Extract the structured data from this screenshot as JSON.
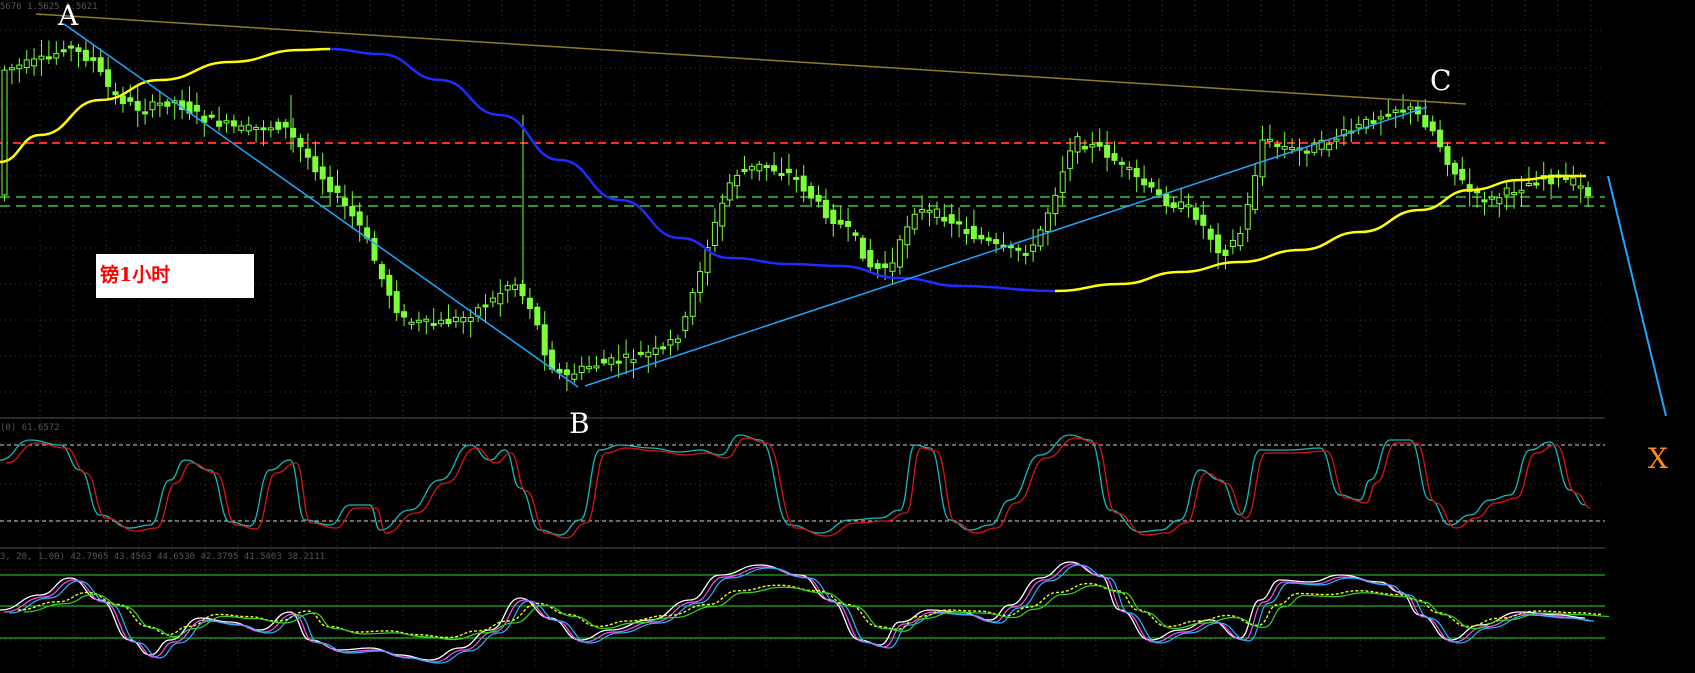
{
  "chart": {
    "symbol_caption": "镑1小时",
    "top_readout": "5676 1.5625 1.5621",
    "stoch_readout": "(0) 61.6572",
    "kdj_readout": "3, 20, 1.00) 42.7965 43.4563 44.6530 42.3795 41.5403 38.2111"
  },
  "wave_labels": {
    "a": "A",
    "b": "B",
    "c": "C",
    "x": "X"
  },
  "colors": {
    "background": "#000000",
    "grid": "#3a3a3a",
    "candle": "#7cff3a",
    "ma_yellow": "#ffff00",
    "ma_blue": "#1f2bff",
    "trendline": "#1ea6ff",
    "top_line": "#8b7d2a",
    "red_level": "#ff2a2a",
    "green_level": "#3fbf3f",
    "stoch_main": "#18b8b8",
    "stoch_signal": "#d81414",
    "kdj_white": "#ffffff",
    "kdj_magenta": "#ff4aff",
    "kdj_cyan": "#25b7ff",
    "kdj_yellow": "#e8ff1a",
    "kdj_green": "#32d42a",
    "x_label": "#ff8c1a"
  }
}
